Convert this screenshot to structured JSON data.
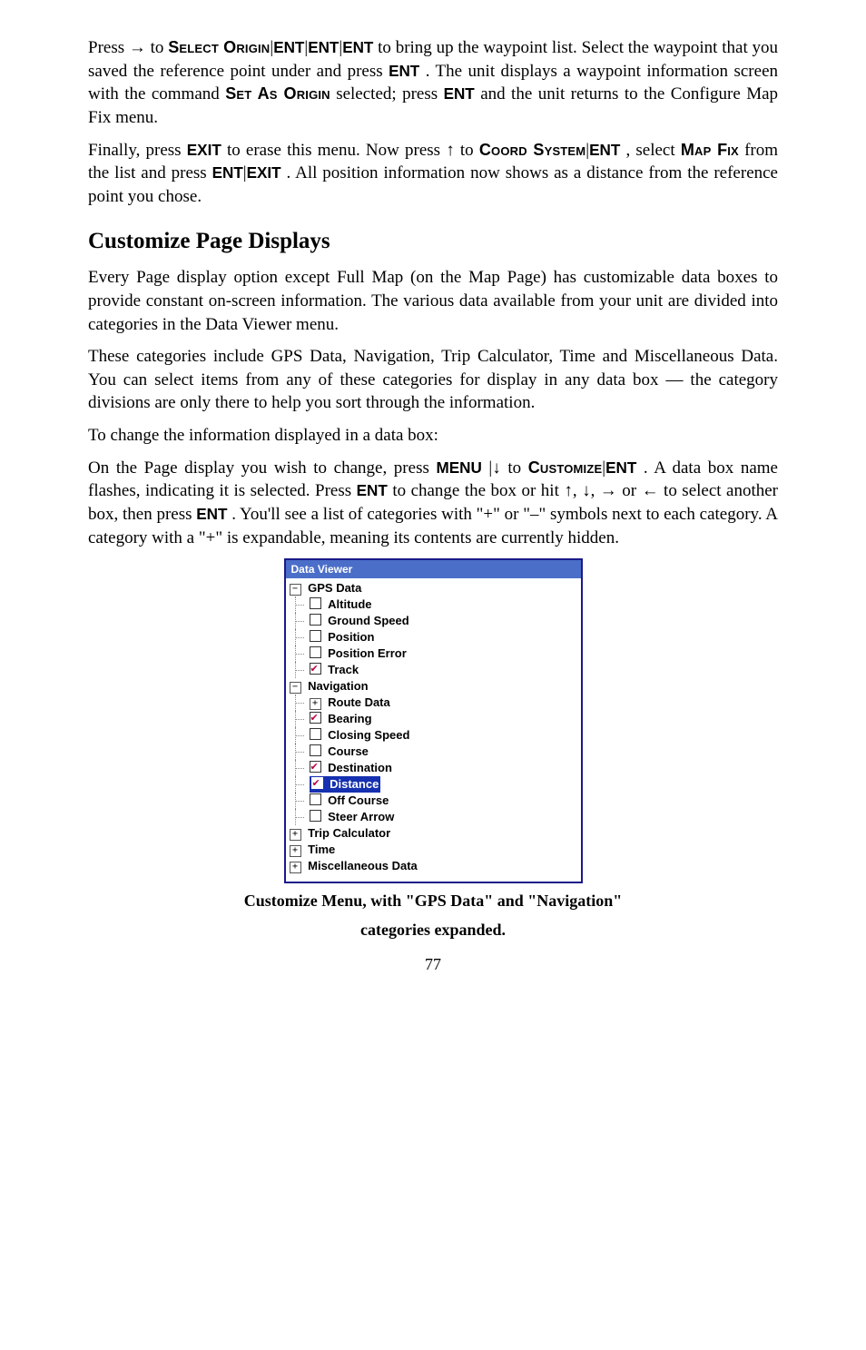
{
  "para1": {
    "a": "Press → to ",
    "b": "|",
    "c": "|",
    "d": "|",
    "e": " to bring up the waypoint list. Select the waypoint that you saved the reference point under and press ",
    "f": ". The unit displays a waypoint information screen with the command ",
    "g": " selected; press ",
    "h": " and the unit returns to the Configure Map Fix menu."
  },
  "keys": {
    "select_origin": "Select Origin",
    "ENT": "ENT",
    "SET_AS_ORIGIN": "Set As Origin",
    "EXIT": "EXIT",
    "COORD_SYSTEM": "Coord System",
    "MAP_FIX": "Map Fix",
    "CUSTOMIZE": "Customize",
    "MENU": "MENU"
  },
  "para2": {
    "a": "Finally, press ",
    "b": " to erase this menu. Now press ↑ to ",
    "c": "|",
    "d": ", select ",
    "e": " from the list and press ",
    "f": "|",
    "g": ". All position information now shows as a distance from the reference point you chose."
  },
  "heading": "Customize Page Displays",
  "para3": "Every Page display option except Full Map (on the Map Page) has customizable data boxes to provide constant on-screen information. The various data available from your unit are divided into categories in the Data Viewer menu.",
  "para4": "These categories include GPS Data, Navigation, Trip Calculator, Time and Miscellaneous Data. You can select items from any of these categories for display in any data box — the category divisions are only there to help you sort through the information.",
  "para5": "To change the information displayed in a data box:",
  "para6": {
    "a": "On the Page display you wish to change, press ",
    "b": " |↓ to ",
    "c": "|",
    "d": ". A data box name flashes, indicating it is selected. Press ",
    "e": " to change the box or hit ↑, ↓, → or ← to select another box, then press ",
    "f": ". You'll see a list of categories with \"+\" or \"–\" symbols next to each category. A category with a \"+\" is expandable, meaning its contents are currently hidden."
  },
  "dv": {
    "title": "Data Viewer",
    "gps_data": {
      "label": "GPS Data",
      "expander": "−"
    },
    "altitude": "Altitude",
    "ground_speed": "Ground Speed",
    "position": "Position",
    "position_error": "Position Error",
    "track": "Track",
    "navigation": {
      "label": "Navigation",
      "expander": "−"
    },
    "route_data": {
      "label": "Route Data",
      "expander": "+"
    },
    "bearing": "Bearing",
    "closing_speed": "Closing Speed",
    "course": "Course",
    "destination": "Destination",
    "distance": "Distance",
    "off_course": "Off Course",
    "steer_arrow": "Steer Arrow",
    "trip_calculator": {
      "label": "Trip Calculator",
      "expander": "+"
    },
    "time": {
      "label": "Time",
      "expander": "+"
    },
    "misc_data": {
      "label": "Miscellaneous Data",
      "expander": "+"
    }
  },
  "caption1": "Customize Menu, with \"GPS Data\" and \"Navigation\"",
  "caption2": "categories expanded.",
  "pagenum": "77"
}
